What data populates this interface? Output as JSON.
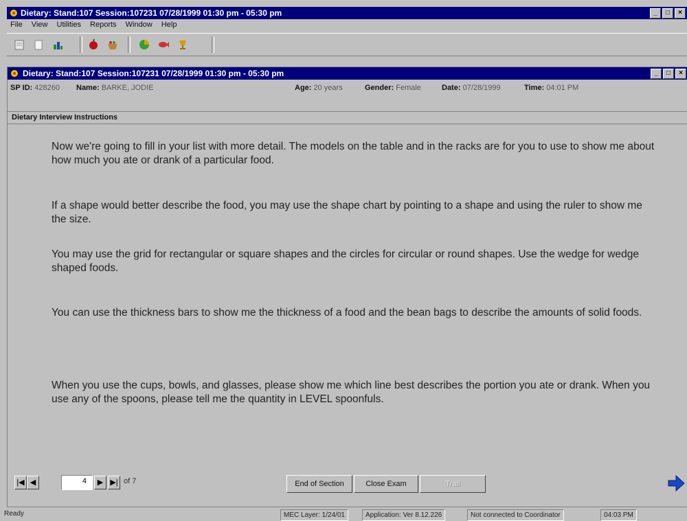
{
  "app": {
    "title": "Dietary: Stand:107 Session:107231 07/28/1999 01:30 pm - 05:30 pm",
    "menus": [
      "File",
      "View",
      "Utilities",
      "Reports",
      "Window",
      "Help"
    ],
    "window_buttons": [
      "_",
      "□",
      "×"
    ]
  },
  "toolbar": {
    "icons": [
      "notepad-icon",
      "page-icon",
      "chart-icon",
      "apple-icon",
      "basket-icon",
      "pie-icon",
      "fish-icon",
      "trophy-icon"
    ]
  },
  "child": {
    "title": "Dietary: Stand:107 Session:107231 07/28/1999 01:30 pm - 05:30 pm",
    "window_buttons": [
      "_",
      "□",
      "×"
    ]
  },
  "info": {
    "spid_label": "SP ID:",
    "spid_value": "428260",
    "name_label": "Name:",
    "name_value": "BARKE, JODIE",
    "age_label": "Age:",
    "age_value": "20 years",
    "gender_label": "Gender:",
    "gender_value": "Female",
    "date_label": "Date:",
    "date_value": "07/28/1999",
    "time_label": "Time:",
    "time_value": "04:01 PM"
  },
  "section": {
    "title": "Dietary Interview Instructions"
  },
  "instructions": [
    "Now we're going to fill in your list with more detail. The models on the table and in the racks are for you to use to show me about how much you ate or drank of a particular food.",
    "If a shape would better describe the food, you may use the shape chart by pointing to a shape and using the ruler to show me the size.",
    "You may use the grid for rectangular or square shapes and the circles for circular or round shapes. Use the wedge for wedge shaped foods.",
    "You can use the thickness bars to show me the thickness of a food and the bean bags to describe the amounts of solid foods.",
    "When you use the cups, bowls, and glasses, please show me which line best describes the portion you ate or drank. When you use any of the spoons, please tell me the quantity in LEVEL spoonfuls."
  ],
  "nav": {
    "first": "|◀",
    "prev": "◀",
    "page": "4",
    "next": "▶",
    "last": "▶|",
    "of_text": "of 7",
    "end_section": "End of Section",
    "close_exam": "Close Exam",
    "disabled_button": "Trail"
  },
  "status": {
    "ready": "Ready",
    "mec": "MEC Layer: 1/24/01",
    "app_ver": "Application: Ver 8.12.226",
    "coordinator": "Not connected to Coordinator",
    "clock": "04:03 PM"
  }
}
